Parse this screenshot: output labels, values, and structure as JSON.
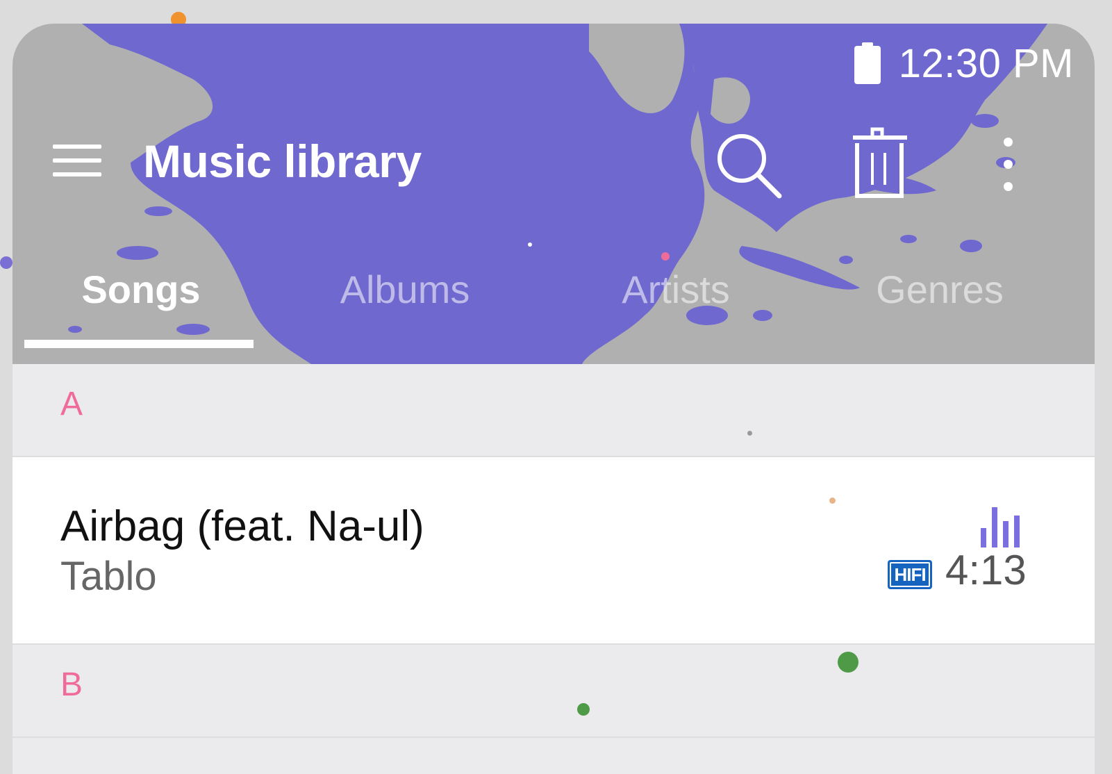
{
  "status_bar": {
    "time": "12:30 PM",
    "battery_icon": "battery-full-icon"
  },
  "toolbar": {
    "menu_icon": "hamburger-menu-icon",
    "title": "Music library",
    "search_icon": "search-icon",
    "delete_icon": "trash-icon",
    "more_icon": "more-vertical-icon"
  },
  "tabs": [
    {
      "label": "Songs",
      "active": true
    },
    {
      "label": "Albums",
      "active": false
    },
    {
      "label": "Artists",
      "active": false
    },
    {
      "label": "Genres",
      "active": false
    }
  ],
  "list": {
    "sections": [
      {
        "letter": "A",
        "songs": [
          {
            "title": "Airbag (feat. Na-ul)",
            "artist": "Tablo",
            "quality_badge": "HIFI",
            "duration": "4:13",
            "now_playing_icon": "equalizer-icon"
          }
        ]
      },
      {
        "letter": "B",
        "songs": []
      }
    ]
  },
  "colors": {
    "accent_purple": "#6f68cf",
    "header_gray": "#b0b0b0",
    "section_letter": "#ef6c9a",
    "hifi_blue": "#1565c0",
    "eq_purple": "#7b6fe0"
  }
}
